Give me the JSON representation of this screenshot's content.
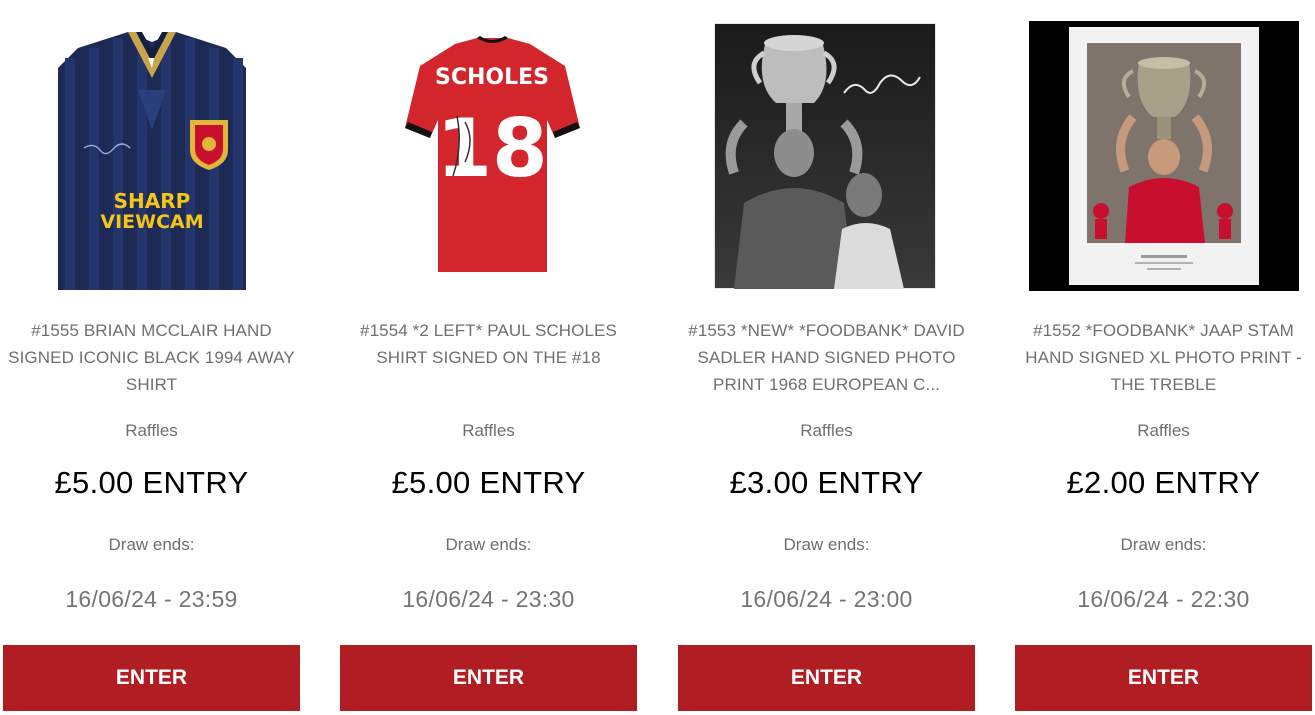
{
  "raffles": [
    {
      "title": "#1555 BRIAN MCCLAIR HAND SIGNED ICONIC BLACK 1994 AWAY SHIRT",
      "category": "Raffles",
      "price": "£5.00 ENTRY",
      "draw_label": "Draw ends:",
      "draw_date": "16/06/24 - 23:59",
      "button_label": "ENTER",
      "image_text": [
        "SHARP",
        "VIEWCAM"
      ]
    },
    {
      "title": "#1554 *2 LEFT* PAUL SCHOLES SHIRT SIGNED ON THE #18",
      "category": "Raffles",
      "price": "£5.00 ENTRY",
      "draw_label": "Draw ends:",
      "draw_date": "16/06/24 - 23:30",
      "button_label": "ENTER",
      "image_text": [
        "SCHOLES",
        "18"
      ]
    },
    {
      "title": "#1553 *NEW* *FOODBANK* DAVID SADLER HAND SIGNED PHOTO PRINT 1968 EUROPEAN C...",
      "category": "Raffles",
      "price": "£3.00 ENTRY",
      "draw_label": "Draw ends:",
      "draw_date": "16/06/24 - 23:00",
      "button_label": "ENTER"
    },
    {
      "title": "#1552 *FOODBANK* JAAP STAM HAND SIGNED XL PHOTO PRINT - THE TREBLE",
      "category": "Raffles",
      "price": "£2.00 ENTRY",
      "draw_label": "Draw ends:",
      "draw_date": "16/06/24 - 22:30",
      "button_label": "ENTER"
    }
  ],
  "colors": {
    "button_bg": "#b01e23",
    "button_text": "#ffffff",
    "title_text": "#6f6f6f",
    "price_text": "#000000"
  }
}
